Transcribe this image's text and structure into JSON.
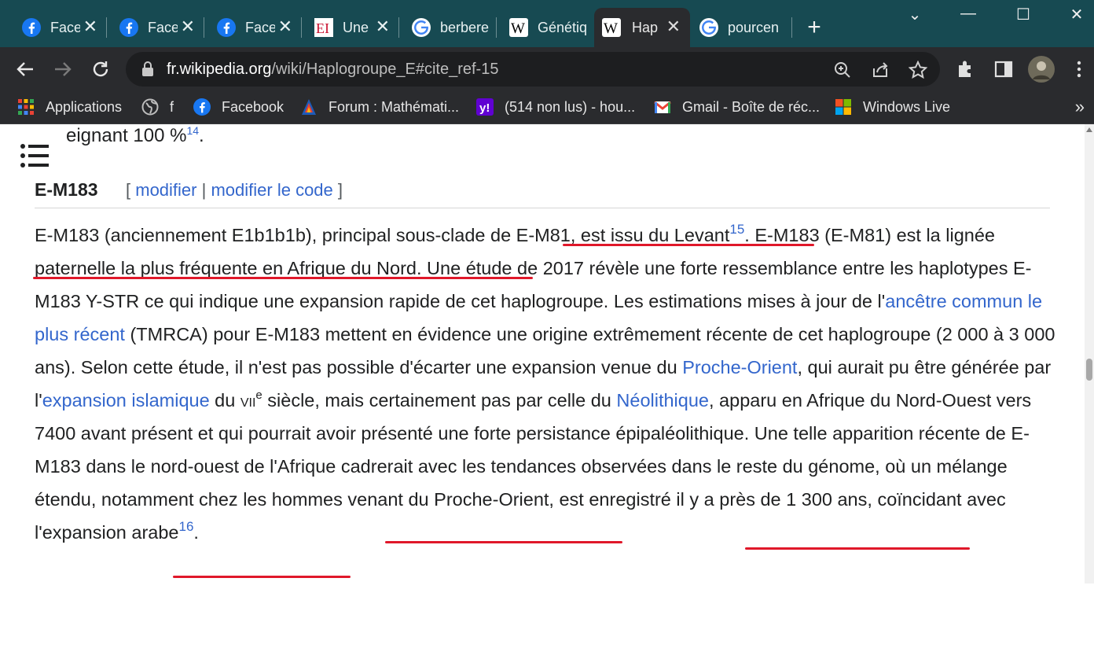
{
  "colors": {
    "tab_strip": "#174a52",
    "toolbar": "#2a2b2e",
    "link": "#3366cc",
    "underline_mark": "#e0182a"
  },
  "tabs": [
    {
      "label": "Facebook",
      "icon": "facebook-icon"
    },
    {
      "label": "Facebook",
      "icon": "facebook-icon"
    },
    {
      "label": "Facebook",
      "icon": "facebook-icon"
    },
    {
      "label": "Une",
      "icon": "ei-icon"
    },
    {
      "label": "berbere",
      "icon": "google-icon"
    },
    {
      "label": "Génétique",
      "icon": "wikipedia-icon"
    },
    {
      "label": "Hap",
      "icon": "wikipedia-icon"
    },
    {
      "label": "pourcentage",
      "icon": "google-icon"
    }
  ],
  "toolbar": {
    "url_host": "fr.wikipedia.org",
    "url_path": "/wiki/Haplogroupe_E#cite_ref-15"
  },
  "bookmarks": [
    {
      "label": "Applications",
      "icon": "apps-grid-icon"
    },
    {
      "label": "f",
      "icon": "globe-icon"
    },
    {
      "label": "Facebook",
      "icon": "facebook-icon"
    },
    {
      "label": "Forum : Mathémati...",
      "icon": "forum-icon"
    },
    {
      "label": "(514 non lus) - hou...",
      "icon": "yahoo-icon"
    },
    {
      "label": "Gmail - Boîte de réc...",
      "icon": "gmail-icon"
    },
    {
      "label": "Windows Live",
      "icon": "windows-icon"
    }
  ],
  "article": {
    "overflow_text": "eignant 100 %",
    "overflow_ref": "14",
    "overflow_end": ".",
    "section_title": "E-M183",
    "edit_open": "[",
    "edit_link": "modifier",
    "edit_sep": "|",
    "edit_code_link": "modifier le code",
    "edit_close": "]",
    "p": {
      "s1": "E-M183 (anciennement E1b1b1b), principal sous-clade de E-M81, est issu du Levant",
      "ref15": "15",
      "s2": ". E-M183 (E-M81) est la lignée paternelle la plus fréquente en Afrique du Nord. Une étude de 2017 révèle une forte ressemblance entre les haplotypes E-M183 Y-STR ce qui indique une expansion rapide de cet haplogroupe. Les estimations mises à jour de l'",
      "link_mrca": "ancêtre commun le plus récent",
      "s3": " (TMRCA) pour E-M183 mettent en évidence une origine extrêmement récente de cet haplogroupe (2 000 à 3 000 ans). Selon cette étude, il n'est pas possible d'écarter une expansion venue du ",
      "link_proche_orient": "Proche-Orient",
      "s4": ", qui aurait pu être générée par l'",
      "link_islamique": "expansion islamique",
      "s5": " du ",
      "century": "vii",
      "century_sup": "e",
      "s6": " siècle, mais certainement pas par celle du ",
      "link_neolithique": "Néolithique",
      "s7": ", apparu en Afrique du Nord-Ouest vers 7400 avant présent et qui pourrait avoir présenté une forte persistance épipaléolithique. Une telle apparition récente de E-M183 dans le nord-ouest de l'Afrique cadrerait avec les tendances observées dans le reste du génome, où un mélange étendu, notamment chez les hommes venant du Proche-Orient, est enregistré il y a près de 1 300 ans, coïncidant avec l'expansion arabe",
      "ref16": "16",
      "s8": "."
    }
  }
}
